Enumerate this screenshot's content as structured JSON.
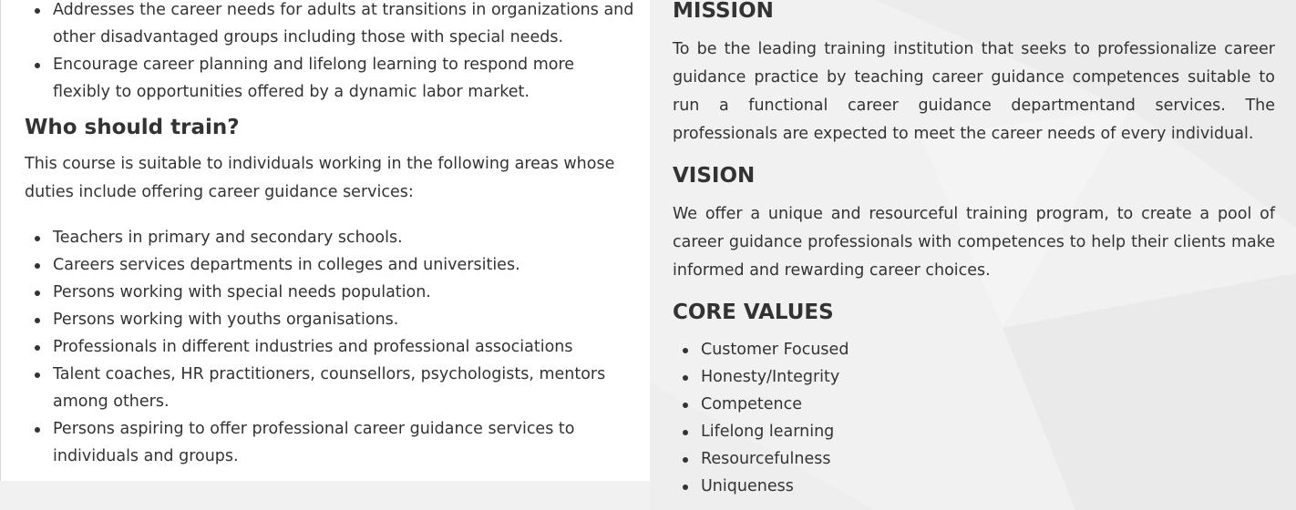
{
  "left": {
    "intro_bullets": [
      "Addresses the career needs for adults at transitions in organizations and other disadvantaged groups including those with special needs.",
      "Encourage career planning and lifelong learning to respond more flexibly to opportunities offered by a dynamic labor market."
    ],
    "who_heading": "Who should train?",
    "who_paragraph": "This course is suitable to individuals working in the following areas whose duties include offering career guidance services:",
    "who_bullets": [
      "Teachers in primary and secondary schools.",
      "Careers services departments in colleges and universities.",
      "Persons working with special needs population.",
      "Persons working with youths organisations.",
      "Professionals in different industries and professional associations",
      "Talent coaches, HR practitioners, counsellors, psychologists, mentors among others.",
      "Persons aspiring to offer professional career guidance services to individuals and groups."
    ]
  },
  "right": {
    "mission_heading": "MISSION",
    "mission_text": "To be the leading training institution that seeks to professionalize career guidance practice by teaching career guidance competences suitable to run a functional career guidance departmentand services. The professionals are expected to meet the career needs of every individual.",
    "vision_heading": "VISION",
    "vision_text": "We offer a unique and resourceful training program, to create a pool of career guidance professionals with competences to help their clients make informed and rewarding career choices.",
    "core_heading": "CORE VALUES",
    "core_values": [
      "Customer Focused",
      "Honesty/Integrity",
      "Competence",
      "Lifelong learning",
      "Resourcefulness",
      "Uniqueness"
    ]
  }
}
